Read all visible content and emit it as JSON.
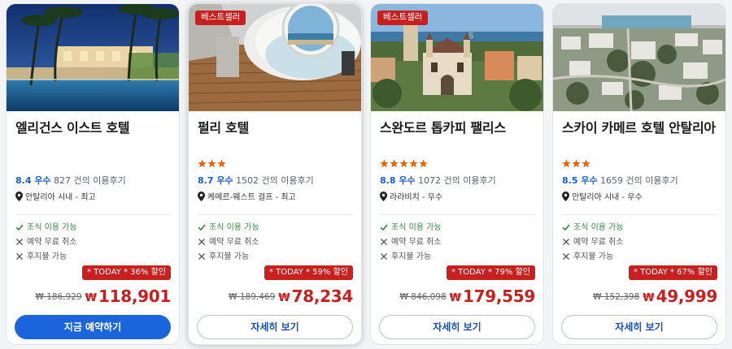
{
  "cards": [
    {
      "name": "엘리건스 이스트 호텔",
      "badge": "",
      "stars": 0,
      "rating_score": "8.4 우수",
      "reviews": "827 건의 이용후기",
      "location": "안탈리아 시내 - 최고",
      "features": [
        "조식 이용 가능",
        "예약 무료 취소",
        "후지불 가능"
      ],
      "deal": "* TODAY * 36% 할인",
      "old_price": "₩ 186,929",
      "currency": "₩",
      "price": "118,901",
      "button": "지금 예약하기"
    },
    {
      "name": "펄리 호텔",
      "badge": "베스트셀러",
      "stars": 3,
      "rating_score": "8.7 우수",
      "reviews": "1502 건의 이용후기",
      "location": "케메르-웨스트 걸프 - 최고",
      "features": [
        "조식 이용 가능",
        "예약 무료 취소",
        "후지불 가능"
      ],
      "deal": "* TODAY * 59% 할인",
      "old_price": "₩ 189,469",
      "currency": "₩",
      "price": "78,234",
      "button": "자세히 보기"
    },
    {
      "name": "스완도르 톱카피 팰리스",
      "badge": "베스트셀러",
      "stars": 5,
      "rating_score": "8.8 우수",
      "reviews": "1072 건의 이용후기",
      "location": "라라비치 - 우수",
      "features": [
        "조식 이용 가능",
        "예약 무료 취소",
        "후지불 가능"
      ],
      "deal": "* TODAY * 79% 할인",
      "old_price": "₩ 846,098",
      "currency": "₩",
      "price": "179,559",
      "button": "자세히 보기"
    },
    {
      "name": "스카이 카메르 호텔 안탈리아",
      "badge": "",
      "stars": 3,
      "rating_score": "8.5 우수",
      "reviews": "1659 건의 이용후기",
      "location": "안탈리아 시내 - 우수",
      "features": [
        "조식 이용 가능",
        "예약 무료 취소",
        "후지불 가능"
      ],
      "deal": "* TODAY * 67% 할인",
      "old_price": "₩ 152,398",
      "currency": "₩",
      "price": "49,999",
      "button": "자세히 보기"
    }
  ],
  "colors": {
    "accent_blue": "#1a64dc",
    "deal_red": "#c81f1f",
    "score_blue": "#1a5fd0",
    "star_orange": "#e8630a",
    "feature_green": "#2b8a3e"
  },
  "icons": {
    "location": "map-pin-icon",
    "available": "check-icon",
    "unavailable": "x-icon",
    "star": "star-icon"
  }
}
